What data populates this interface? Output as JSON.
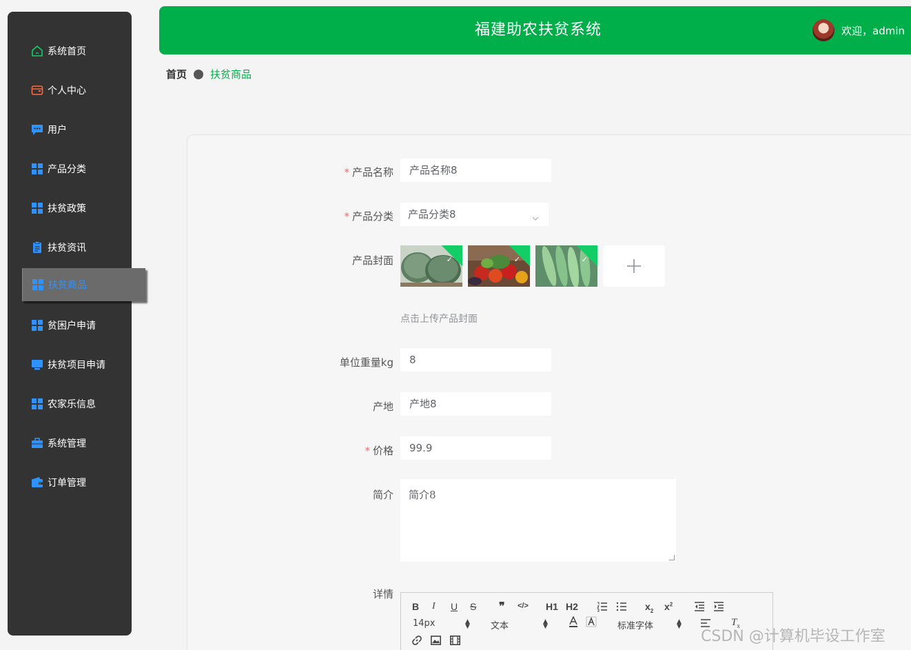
{
  "header": {
    "title": "福建助农扶贫系统",
    "welcome": "欢迎，admin",
    "brand_color": "#00af4a"
  },
  "sidebar": {
    "items": [
      {
        "label": "系统首页",
        "icon": "home-icon"
      },
      {
        "label": "个人中心",
        "icon": "wallet-icon"
      },
      {
        "label": "用户",
        "icon": "chat-icon"
      },
      {
        "label": "产品分类",
        "icon": "grid-icon"
      },
      {
        "label": "扶贫政策",
        "icon": "grid-icon"
      },
      {
        "label": "扶贫资讯",
        "icon": "clipboard-icon"
      },
      {
        "label": "扶贫商品",
        "icon": "grid-icon",
        "active": true
      },
      {
        "label": "贫困户申请",
        "icon": "grid-icon"
      },
      {
        "label": "扶贫项目申请",
        "icon": "monitor-icon"
      },
      {
        "label": "农家乐信息",
        "icon": "grid-icon"
      },
      {
        "label": "系统管理",
        "icon": "briefcase-icon"
      },
      {
        "label": "订单管理",
        "icon": "wallet-icon"
      }
    ]
  },
  "breadcrumb": {
    "home": "首页",
    "current": "扶贫商品"
  },
  "form": {
    "product_name": {
      "label": "产品名称",
      "value": "产品名称8",
      "required": true
    },
    "category": {
      "label": "产品分类",
      "value": "产品分类8",
      "required": true
    },
    "cover": {
      "label": "产品封面",
      "tip": "点击上传产品封面",
      "images": [
        "winter-melon",
        "vegetables",
        "loofah"
      ]
    },
    "weight": {
      "label": "单位重量kg",
      "value": "8"
    },
    "origin": {
      "label": "产地",
      "value": "产地8"
    },
    "price": {
      "label": "价格",
      "value": "99.9",
      "required": true
    },
    "intro": {
      "label": "简介",
      "value": "简介8"
    },
    "detail": {
      "label": "详情"
    }
  },
  "editor": {
    "font_size": "14px",
    "block_format": "文本",
    "font_family": "标准字体",
    "buttons_row1": [
      "B",
      "I",
      "U",
      "S",
      "❞",
      "</>",
      "H1",
      "H2",
      "ordered-list",
      "bullet-list",
      "X2",
      "X2",
      "outdent",
      "indent"
    ],
    "clear": "Tx"
  },
  "watermark": "CSDN @计算机毕设工作室",
  "colors": {
    "sidebar_bg": "#333333",
    "active_text": "#2f93ff",
    "required": "#f56c6c"
  }
}
